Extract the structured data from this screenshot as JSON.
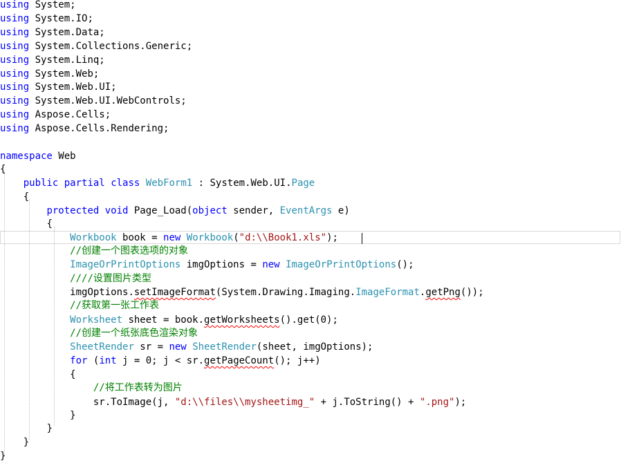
{
  "code": {
    "using_keyword": "using",
    "usings": [
      "System;",
      "System.IO;",
      "System.Data;",
      "System.Collections.Generic;",
      "System.Linq;",
      "System.Web;",
      "System.Web.UI;",
      "System.Web.UI.WebControls;",
      "Aspose.Cells;",
      "Aspose.Cells.Rendering;"
    ],
    "namespace_keyword": "namespace",
    "namespace_name": " Web",
    "open_brace": "{",
    "close_brace": "}",
    "class_public": "public",
    "class_partial": "partial",
    "class_class": "class",
    "class_name": "WebForm1",
    "class_colon": " : System.Web.UI.",
    "class_base": "Page",
    "method_protected": "protected",
    "method_void": "void",
    "method_name": " Page_Load(",
    "method_object": "object",
    "method_sender": " sender, ",
    "method_eventargs": "EventArgs",
    "method_e": " e)",
    "l_workbook_type": "Workbook",
    "l_workbook_mid": " book = ",
    "l_new": "new",
    "l_workbook_ctor": "Workbook",
    "l_workbook_open": "(",
    "l_workbook_str": "\"d:\\\\Book1.xls\"",
    "l_workbook_end": ");",
    "c1": "//创建一个图表选项的对象",
    "l_imgopt_type": "ImageOrPrintOptions",
    "l_imgopt_mid": " imgOptions = ",
    "l_imgopt_ctor": "ImageOrPrintOptions",
    "l_imgopt_end": "();",
    "c2": "////设置图片类型",
    "l_setimg_a": "imgOptions.",
    "l_setimg_method": "setImageFormat",
    "l_setimg_b": "(System.Drawing.Imaging.",
    "l_setimg_type": "ImageFormat",
    "l_setimg_dot": ".",
    "l_setimg_png": "getPng",
    "l_setimg_end": "());",
    "c3": "//获取第一张工作表",
    "l_ws_type": "Worksheet",
    "l_ws_mid": " sheet = book.",
    "l_ws_method": "getWorksheets",
    "l_ws_end": "().get(0);",
    "c4": "//创建一个纸张底色渲染对象",
    "l_sr_type": "SheetRender",
    "l_sr_mid": " sr = ",
    "l_sr_ctor": "SheetRender",
    "l_sr_end": "(sheet, imgOptions);",
    "l_for": "for",
    "l_for_a": " (",
    "l_int": "int",
    "l_for_b": " j = 0; j < sr.",
    "l_for_method": "getPageCount",
    "l_for_end": "(); j++)",
    "c5": "//将工作表转为图片",
    "l_toimg_a": "sr.ToImage(j, ",
    "l_toimg_str": "\"d:\\\\files\\\\mysheetimg_\"",
    "l_toimg_b": " + j.ToString() + ",
    "l_toimg_str2": "\".png\"",
    "l_toimg_end": ");"
  }
}
